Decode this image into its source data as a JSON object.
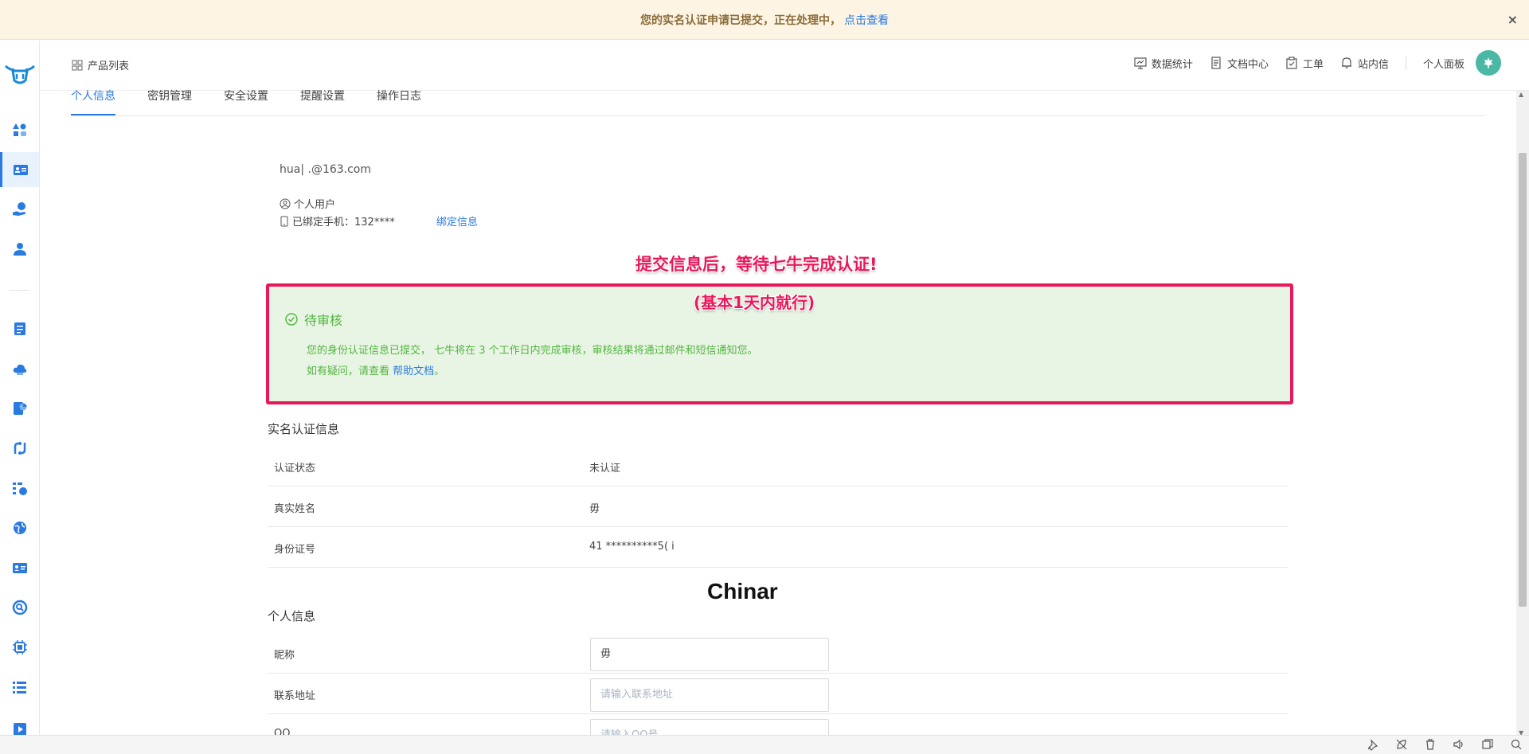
{
  "notice": {
    "message": "您的实名认证申请已提交，正在处理中，",
    "link": "点击查看",
    "close": "×"
  },
  "header": {
    "product_list": "产品列表",
    "nav": [
      "数据统计",
      "文档中心",
      "工单",
      "站内信"
    ],
    "panel": "个人面板"
  },
  "tabs": [
    "个人信息",
    "密钥管理",
    "安全设置",
    "提醒设置",
    "操作日志"
  ],
  "profile": {
    "email": "hua|    .@163.com",
    "user_type": "个人用户",
    "phone_label": "已绑定手机：132****",
    "bind_link": "绑定信息"
  },
  "annotations": {
    "line1": "提交信息后，等待七牛完成认证!",
    "line2": "(基本1天内就行)"
  },
  "pending": {
    "title": "待审核",
    "line1": "您的身份认证信息已提交， 七牛将在 3 个工作日内完成审核，审核结果将通过邮件和短信通知您。",
    "line2_prefix": "如有疑问，请查看 ",
    "line2_link": "帮助文档",
    "line2_suffix": "。"
  },
  "realname": {
    "title": "实名认证信息",
    "rows": [
      {
        "label": "认证状态",
        "value": "未认证"
      },
      {
        "label": "真实姓名",
        "value": "毋"
      },
      {
        "label": "身份证号",
        "value": "41    **********5(   i"
      }
    ]
  },
  "personal": {
    "title": "个人信息",
    "rows": [
      {
        "label": "昵称",
        "value": "毋",
        "placeholder": ""
      },
      {
        "label": "联系地址",
        "value": "",
        "placeholder": "请输入联系地址"
      },
      {
        "label": "QQ",
        "value": "",
        "placeholder": "请输入QQ号"
      }
    ]
  },
  "watermark": "Chinar",
  "colors": {
    "accent": "#2a7ae2",
    "success": "#52b540",
    "annotation": "#e8185b",
    "notice_bg": "#fdf4e3"
  }
}
